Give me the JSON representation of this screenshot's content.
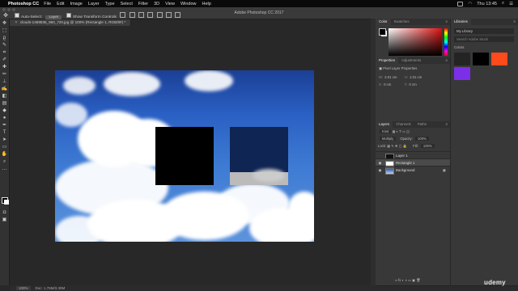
{
  "menubar": {
    "app": "Photoshop CC",
    "items": [
      "File",
      "Edit",
      "Image",
      "Layer",
      "Type",
      "Select",
      "Filter",
      "3D",
      "View",
      "Window",
      "Help"
    ],
    "clock": "Thu 13:45"
  },
  "window": {
    "title": "Adobe Photoshop CC 2017"
  },
  "options": {
    "auto_select": "Auto-Select:",
    "auto_select_value": "Layer",
    "transform": "Show Transform Controls"
  },
  "document": {
    "tab": "clouds-1469836_960_720.jpg @ 100% (Rectangle 1, RGB/8#) *"
  },
  "colors": {
    "accent_swatch": "#ff4a1c",
    "black": "#000000",
    "purple": "#7b2fe8"
  },
  "panels": {
    "color": {
      "tabs": [
        "Color",
        "Swatches"
      ]
    },
    "properties": {
      "tabs": [
        "Properties",
        "Adjustments"
      ],
      "subtitle": "Pixel Layer Properties",
      "w": "3.01 cm",
      "h": "1.01 cm",
      "x": "0 cm",
      "y": "0 cm",
      "labels": {
        "w": "W:",
        "h": "H:",
        "x": "X:",
        "y": "Y:"
      }
    },
    "layers": {
      "tabs": [
        "Layers",
        "Channels",
        "Paths"
      ],
      "kind": "Kind",
      "blend": "Multiply",
      "opacity_label": "Opacity:",
      "opacity": "100%",
      "lock_label": "Lock:",
      "fill_label": "Fill:",
      "fill": "100%",
      "items": [
        {
          "name": "Layer 1",
          "visible": false,
          "selected": false
        },
        {
          "name": "Rectangle 1",
          "visible": true,
          "selected": true
        },
        {
          "name": "Background",
          "visible": true,
          "selected": false
        }
      ]
    },
    "libraries": {
      "title": "Libraries",
      "library": "My Library",
      "search": "Search Adobe Stock",
      "section": "Colors"
    }
  },
  "status": {
    "zoom": "100%",
    "doc": "Doc: 1.76M/3.30M"
  },
  "watermark": "udemy"
}
